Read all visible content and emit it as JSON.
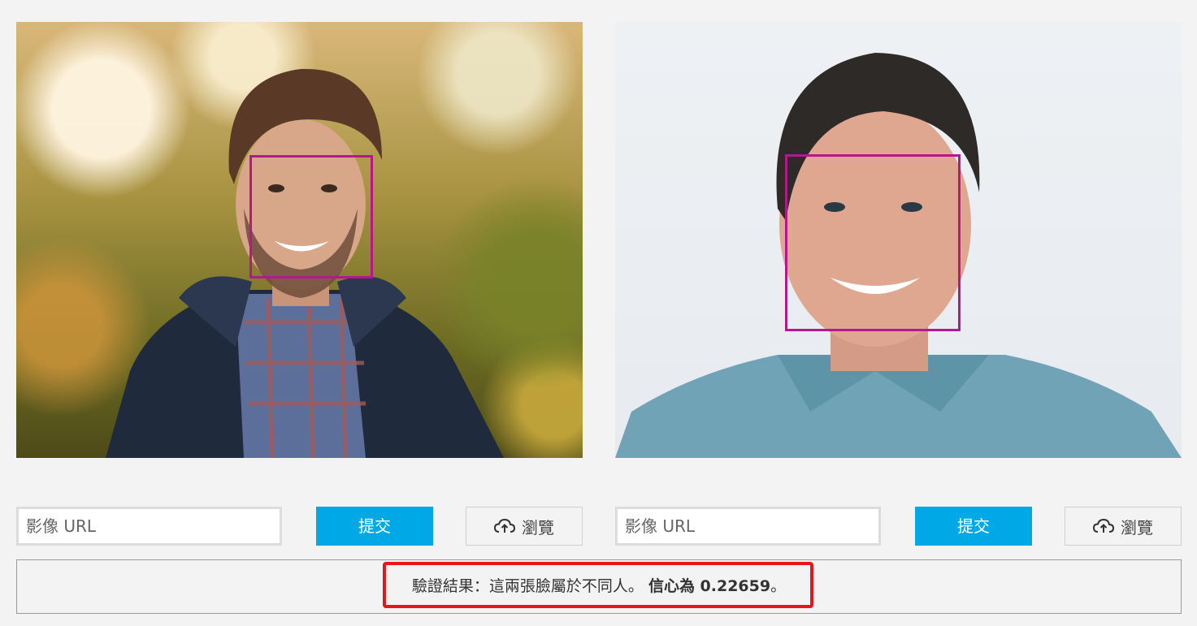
{
  "left_panel": {
    "url_placeholder": "影像 URL",
    "submit_label": "提交",
    "browse_label": "瀏覽"
  },
  "right_panel": {
    "url_placeholder": "影像 URL",
    "submit_label": "提交",
    "browse_label": "瀏覽"
  },
  "result": {
    "prefix": "驗證結果：這兩張臉屬於不同人。",
    "confidence_label": "信心為 0.22659",
    "suffix": "。"
  },
  "colors": {
    "accent": "#00a8e6",
    "face_box": "#b5178f",
    "highlight": "#e8141b"
  },
  "icons": {
    "browse": "cloud-upload-icon"
  }
}
